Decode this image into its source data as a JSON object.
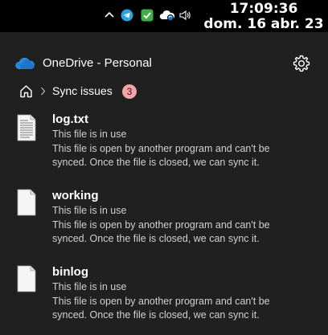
{
  "taskbar": {
    "clock_time": "17:09:36",
    "clock_date": "dom. 16 abr. 23",
    "tray_icons": [
      "chevron-up-icon",
      "telegram-icon",
      "security-check-icon",
      "onedrive-sync-icon",
      "volume-icon"
    ]
  },
  "flyout": {
    "title": "OneDrive - Personal",
    "breadcrumb": {
      "label": "Sync issues",
      "count": "3"
    },
    "items": [
      {
        "name": "log.txt",
        "status": "This file is in use",
        "description": "This file is open by another program and can't be synced. Once the file is closed, we can sync it.",
        "icon": "text-file-icon"
      },
      {
        "name": "working",
        "status": "This file is in use",
        "description": "This file is open by another program and can't be synced. Once the file is closed, we can sync it.",
        "icon": "blank-file-icon"
      },
      {
        "name": "binlog",
        "status": "This file is in use",
        "description": "This file is open by another program and can't be synced. Once the file is closed, we can sync it.",
        "icon": "blank-file-icon"
      }
    ]
  },
  "colors": {
    "panel_bg": "#202020",
    "badge_bg": "#f3a4a8",
    "onedrive_blue": "#2b8ad8"
  }
}
